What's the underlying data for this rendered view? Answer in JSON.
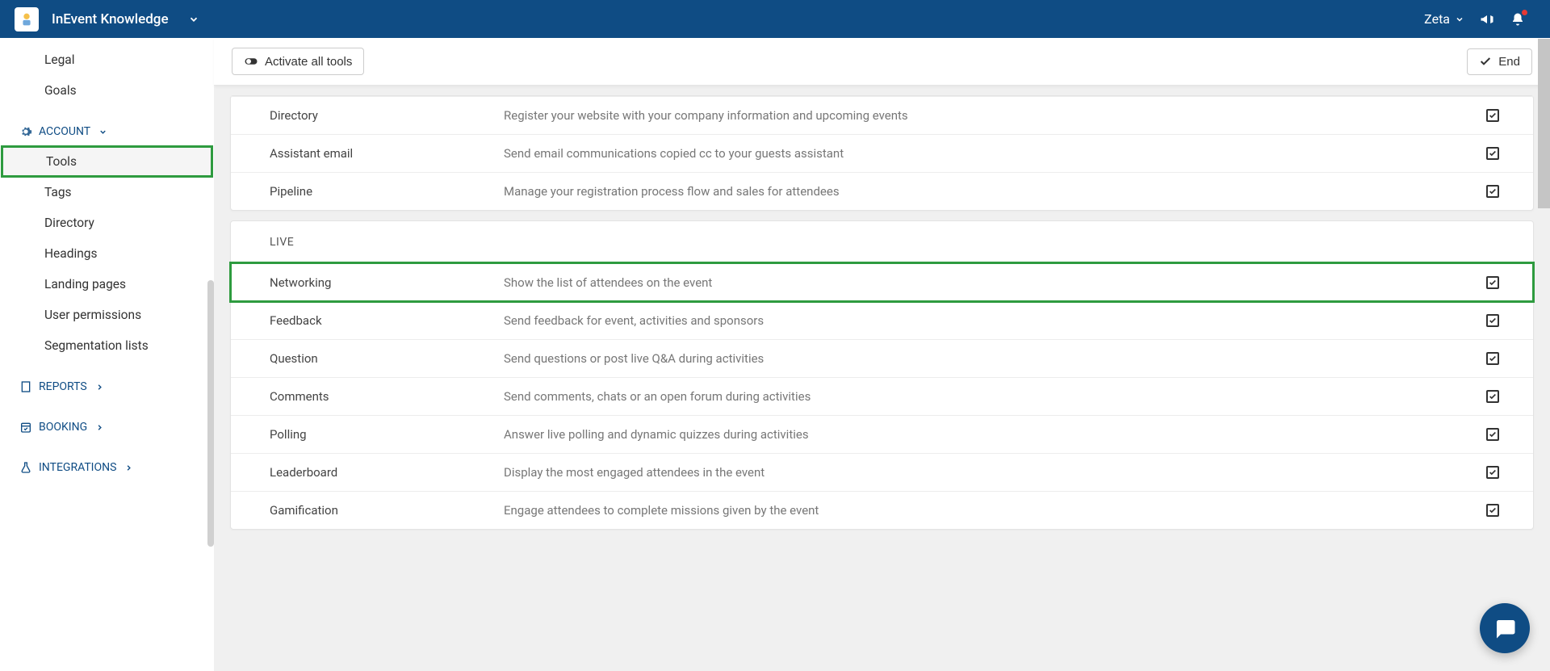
{
  "header": {
    "title": "InEvent Knowledge",
    "user": "Zeta"
  },
  "toolbar": {
    "activate_label": "Activate all tools",
    "end_label": "End"
  },
  "sidebar": {
    "top_items": [
      {
        "label": "Legal"
      },
      {
        "label": "Goals"
      }
    ],
    "sections": [
      {
        "label": "ACCOUNT",
        "expanded": true,
        "items": [
          {
            "label": "Tools",
            "highlighted": true
          },
          {
            "label": "Tags"
          },
          {
            "label": "Directory"
          },
          {
            "label": "Headings"
          },
          {
            "label": "Landing pages"
          },
          {
            "label": "User permissions"
          },
          {
            "label": "Segmentation lists"
          }
        ]
      },
      {
        "label": "REPORTS",
        "expanded": false,
        "items": []
      },
      {
        "label": "BOOKING",
        "expanded": false,
        "items": []
      },
      {
        "label": "INTEGRATIONS",
        "expanded": false,
        "items": []
      }
    ]
  },
  "panels": [
    {
      "title": "",
      "partial": true,
      "rows": [
        {
          "name": "Directory",
          "desc": "Register your website with your company information and upcoming events",
          "checked": true
        },
        {
          "name": "Assistant email",
          "desc": "Send email communications copied cc to your guests assistant",
          "checked": true
        },
        {
          "name": "Pipeline",
          "desc": "Manage your registration process flow and sales for attendees",
          "checked": true
        }
      ]
    },
    {
      "title": "LIVE",
      "rows": [
        {
          "name": "Networking",
          "desc": "Show the list of attendees on the event",
          "checked": true,
          "highlighted": true
        },
        {
          "name": "Feedback",
          "desc": "Send feedback for event, activities and sponsors",
          "checked": true
        },
        {
          "name": "Question",
          "desc": "Send questions or post live Q&A during activities",
          "checked": true
        },
        {
          "name": "Comments",
          "desc": "Send comments, chats or an open forum during activities",
          "checked": true
        },
        {
          "name": "Polling",
          "desc": "Answer live polling and dynamic quizzes during activities",
          "checked": true
        },
        {
          "name": "Leaderboard",
          "desc": "Display the most engaged attendees in the event",
          "checked": true
        },
        {
          "name": "Gamification",
          "desc": "Engage attendees to complete missions given by the event",
          "checked": true
        }
      ]
    }
  ],
  "icons": {
    "account": "gear",
    "reports": "building",
    "booking": "calendar-check",
    "integrations": "flask"
  }
}
